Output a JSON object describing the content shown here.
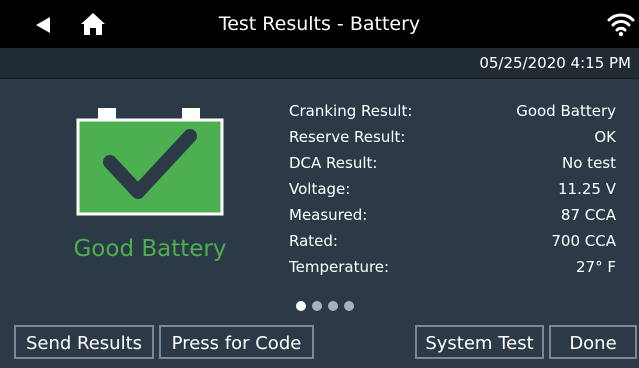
{
  "header": {
    "title": "Test Results - Battery",
    "datetime": "05/25/2020 4:15 PM",
    "icons": {
      "back": "back-arrow-icon",
      "home": "home-icon",
      "wifi": "wifi-icon"
    }
  },
  "status": {
    "label": "Good Battery",
    "icon": "battery-check-icon",
    "color": "#4caf50"
  },
  "results": [
    {
      "label": "Cranking Result:",
      "value": "Good Battery"
    },
    {
      "label": "Reserve Result:",
      "value": "OK"
    },
    {
      "label": "DCA Result:",
      "value": "No test"
    },
    {
      "label": "Voltage:",
      "value": "11.25 V"
    },
    {
      "label": "Measured:",
      "value": "87 CCA"
    },
    {
      "label": "Rated:",
      "value": "700 CCA"
    },
    {
      "label": "Temperature:",
      "value": "27° F"
    }
  ],
  "pagination": {
    "current_page": 1,
    "total_pages": 4
  },
  "buttons": {
    "send_results": "Send Results",
    "press_for_code": "Press for Code",
    "system_test": "System Test",
    "done": "Done"
  }
}
